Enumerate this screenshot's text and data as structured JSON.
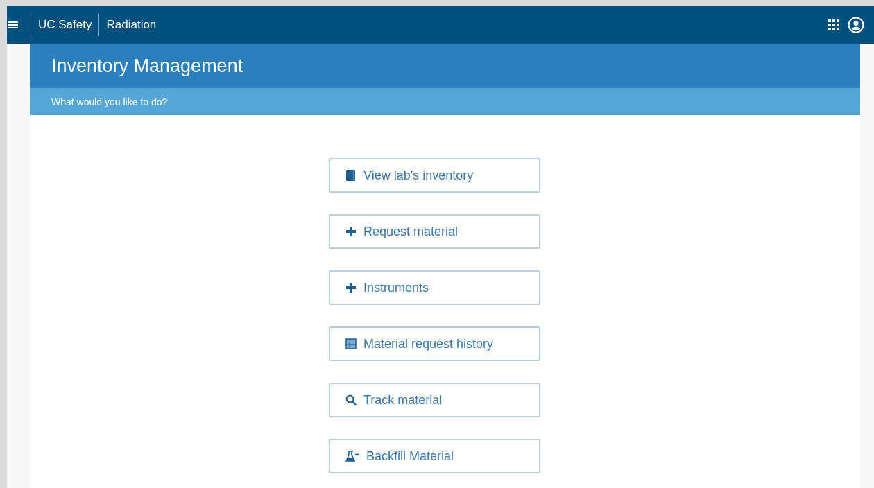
{
  "topbar": {
    "brand": "UC Safety",
    "section": "Radiation"
  },
  "page": {
    "title": "Inventory Management",
    "prompt": "What would you like to do?"
  },
  "actions": [
    {
      "label": "View lab's inventory",
      "kind": "book"
    },
    {
      "label": "Request material",
      "kind": "plus"
    },
    {
      "label": "Instruments",
      "kind": "plus"
    },
    {
      "label": "Material request history",
      "kind": "table"
    },
    {
      "label": "Track material",
      "kind": "search"
    },
    {
      "label": "Backfill Material",
      "kind": "flask"
    }
  ]
}
